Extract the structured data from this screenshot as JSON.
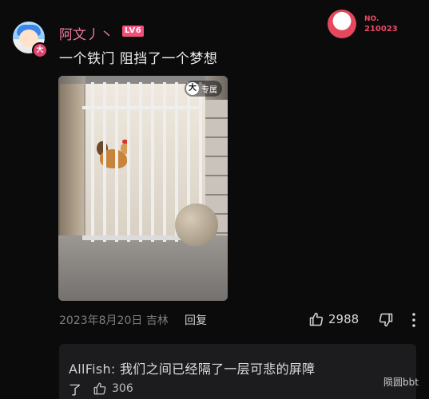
{
  "comment": {
    "avatar_badge": "大",
    "username": "阿文丿丶",
    "level": "LV6",
    "fan_badge": {
      "label": "NO.",
      "number": "210023"
    },
    "text": "一个铁门 阻挡了一个梦想",
    "video": {
      "exclusive_icon": "大",
      "exclusive_label": "专属"
    },
    "date": "2023年8月20日",
    "location": "吉林",
    "reply_label": "回复",
    "likes": "2988",
    "icons": {
      "like": "thumbs-up-icon",
      "dislike": "thumbs-down-icon",
      "more": "more-vertical-icon"
    }
  },
  "reply": {
    "author": "AllFish:",
    "text_line1": " 我们之间已经隔了一层可悲的屏障",
    "text_line2": "了",
    "likes": "306"
  },
  "watermark": "陨圆bbt",
  "colors": {
    "username": "#f2789a",
    "level_badge": "#f2507c",
    "background": "#0b0b0c"
  }
}
